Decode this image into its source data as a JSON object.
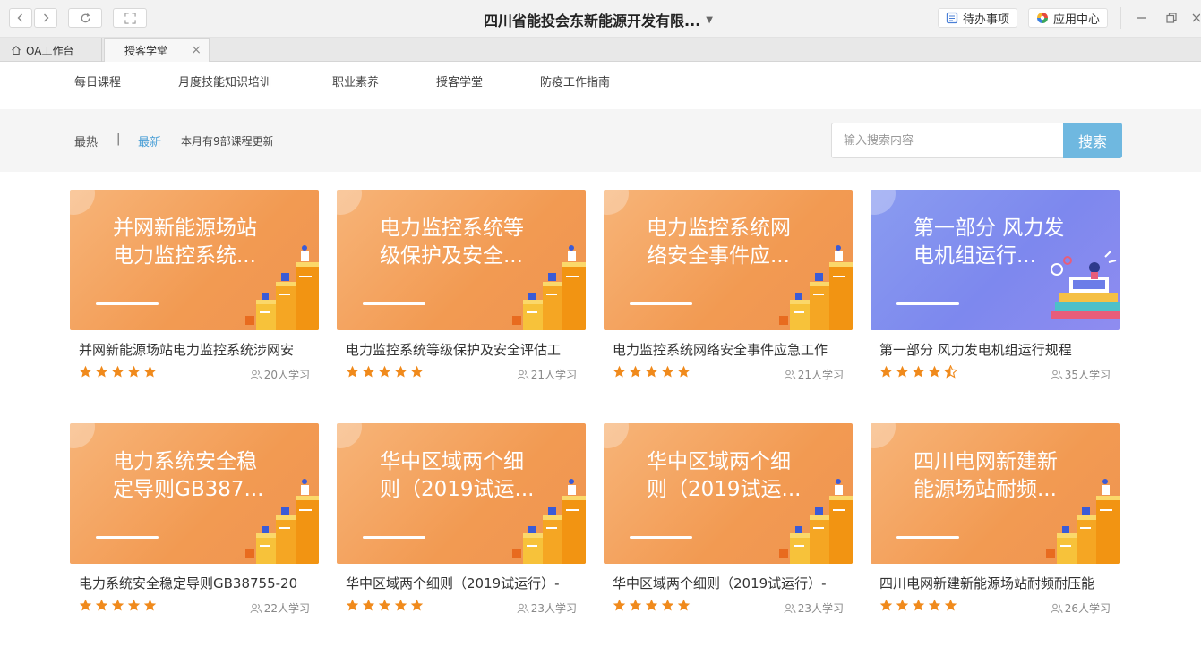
{
  "window": {
    "title": "四川省能投会东新能源开发有限...",
    "todo_label": "待办事项",
    "apps_label": "应用中心"
  },
  "tabs": [
    {
      "label": "OA工作台"
    },
    {
      "label": "授客学堂"
    }
  ],
  "category_nav": {
    "items": [
      "每日课程",
      "月度技能知识培训",
      "职业素养",
      "授客学堂",
      "防疫工作指南"
    ]
  },
  "filters": {
    "hot": "最热",
    "divider": "|",
    "latest": "最新",
    "note": "本月有9部课程更新"
  },
  "search": {
    "placeholder": "输入搜索内容",
    "button": "搜索"
  },
  "courses": [
    {
      "thumb_title": "并网新能源场站电力监控系统...",
      "name": "并网新能源场站电力监控系统涉网安",
      "rating": 5,
      "learners": "20人学习",
      "theme": "orange"
    },
    {
      "thumb_title": "电力监控系统等级保护及安全...",
      "name": "电力监控系统等级保护及安全评估工",
      "rating": 5,
      "learners": "21人学习",
      "theme": "orange"
    },
    {
      "thumb_title": "电力监控系统网络安全事件应...",
      "name": "电力监控系统网络安全事件应急工作",
      "rating": 5,
      "learners": "21人学习",
      "theme": "orange"
    },
    {
      "thumb_title": "第一部分 风力发电机组运行...",
      "name": "第一部分 风力发电机组运行规程",
      "rating": 4.5,
      "learners": "35人学习",
      "theme": "blue"
    },
    {
      "thumb_title": "电力系统安全稳定导则GB387...",
      "name": "电力系统安全稳定导则GB38755-20",
      "rating": 5,
      "learners": "22人学习",
      "theme": "orange"
    },
    {
      "thumb_title": "华中区域两个细则（2019试运...",
      "name": "华中区域两个细则（2019试运行）-",
      "rating": 5,
      "learners": "23人学习",
      "theme": "orange"
    },
    {
      "thumb_title": "华中区域两个细则（2019试运...",
      "name": "华中区域两个细则（2019试运行）-",
      "rating": 5,
      "learners": "23人学习",
      "theme": "orange"
    },
    {
      "thumb_title": "四川电网新建新能源场站耐频...",
      "name": "四川电网新建新能源场站耐频耐压能",
      "rating": 5,
      "learners": "26人学习",
      "theme": "orange"
    }
  ],
  "colors": {
    "accent": "#4a9fd6",
    "search_button": "#6fb8e0",
    "star": "#f08a1c",
    "card_orange": "#f29a52",
    "card_blue": "#7d88ee"
  },
  "icons": {
    "back": "chevron-left-icon",
    "forward": "chevron-right-icon",
    "reload": "reload-icon",
    "fullscreen": "fullscreen-icon",
    "todo": "todo-icon",
    "apps": "apps-icon",
    "minimize": "minimize-icon",
    "restore": "restore-icon",
    "close": "close-icon",
    "home": "home-icon",
    "learners": "people-icon",
    "star": "star-icon"
  }
}
